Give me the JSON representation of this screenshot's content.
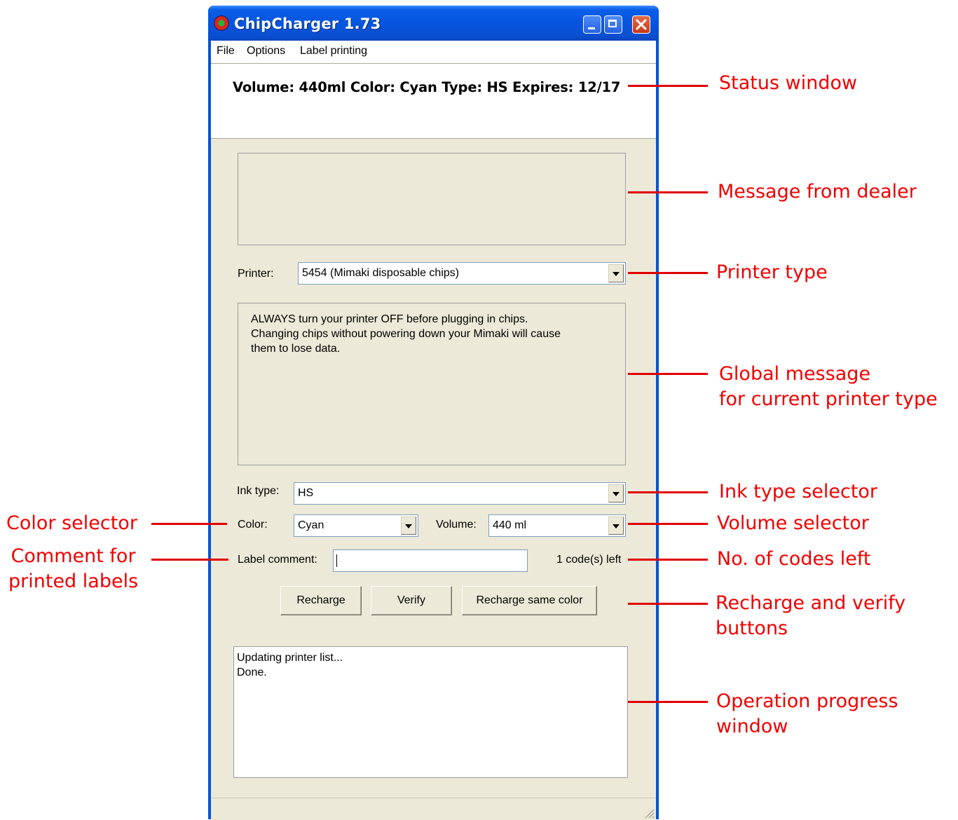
{
  "window": {
    "title": "ChipCharger 1.73"
  },
  "menu": [
    "File",
    "Options",
    "Label printing"
  ],
  "status": {
    "text": "Volume: 440ml  Color: Cyan  Type: HS  Expires: 12/17"
  },
  "printer": {
    "label": "Printer:",
    "value": "5454 (Mimaki disposable chips)"
  },
  "global_message": {
    "lines": [
      "ALWAYS turn your printer OFF before plugging in chips.",
      "Changing chips without powering down your Mimaki will cause",
      "them to lose data."
    ]
  },
  "ink_type": {
    "label": "Ink type:",
    "value": "HS"
  },
  "color": {
    "label": "Color:",
    "value": "Cyan"
  },
  "volume": {
    "label": "Volume:",
    "value": "440 ml"
  },
  "label_comment": {
    "label": "Label comment:",
    "value": ""
  },
  "codes_left": "1 code(s) left",
  "buttons": {
    "recharge": "Recharge",
    "verify": "Verify",
    "recharge_same": "Recharge same color"
  },
  "log": [
    "Updating printer list...",
    "Done."
  ],
  "annotations": {
    "status_window": "Status window",
    "dealer_message": "Message from dealer",
    "printer_type": "Printer type",
    "global_message": "Global message\nfor current printer type",
    "ink_type_selector": "Ink type selector",
    "volume_selector": "Volume selector",
    "codes_left": "No. of codes left",
    "buttons": "Recharge and verify\nbuttons",
    "progress": "Operation progress\nwindow",
    "color_selector": "Color selector",
    "comment": "Comment for\nprinted labels"
  },
  "colors": {
    "annotation": "#e00000",
    "titlebar": "#0a55de",
    "client": "#ece9d8"
  }
}
